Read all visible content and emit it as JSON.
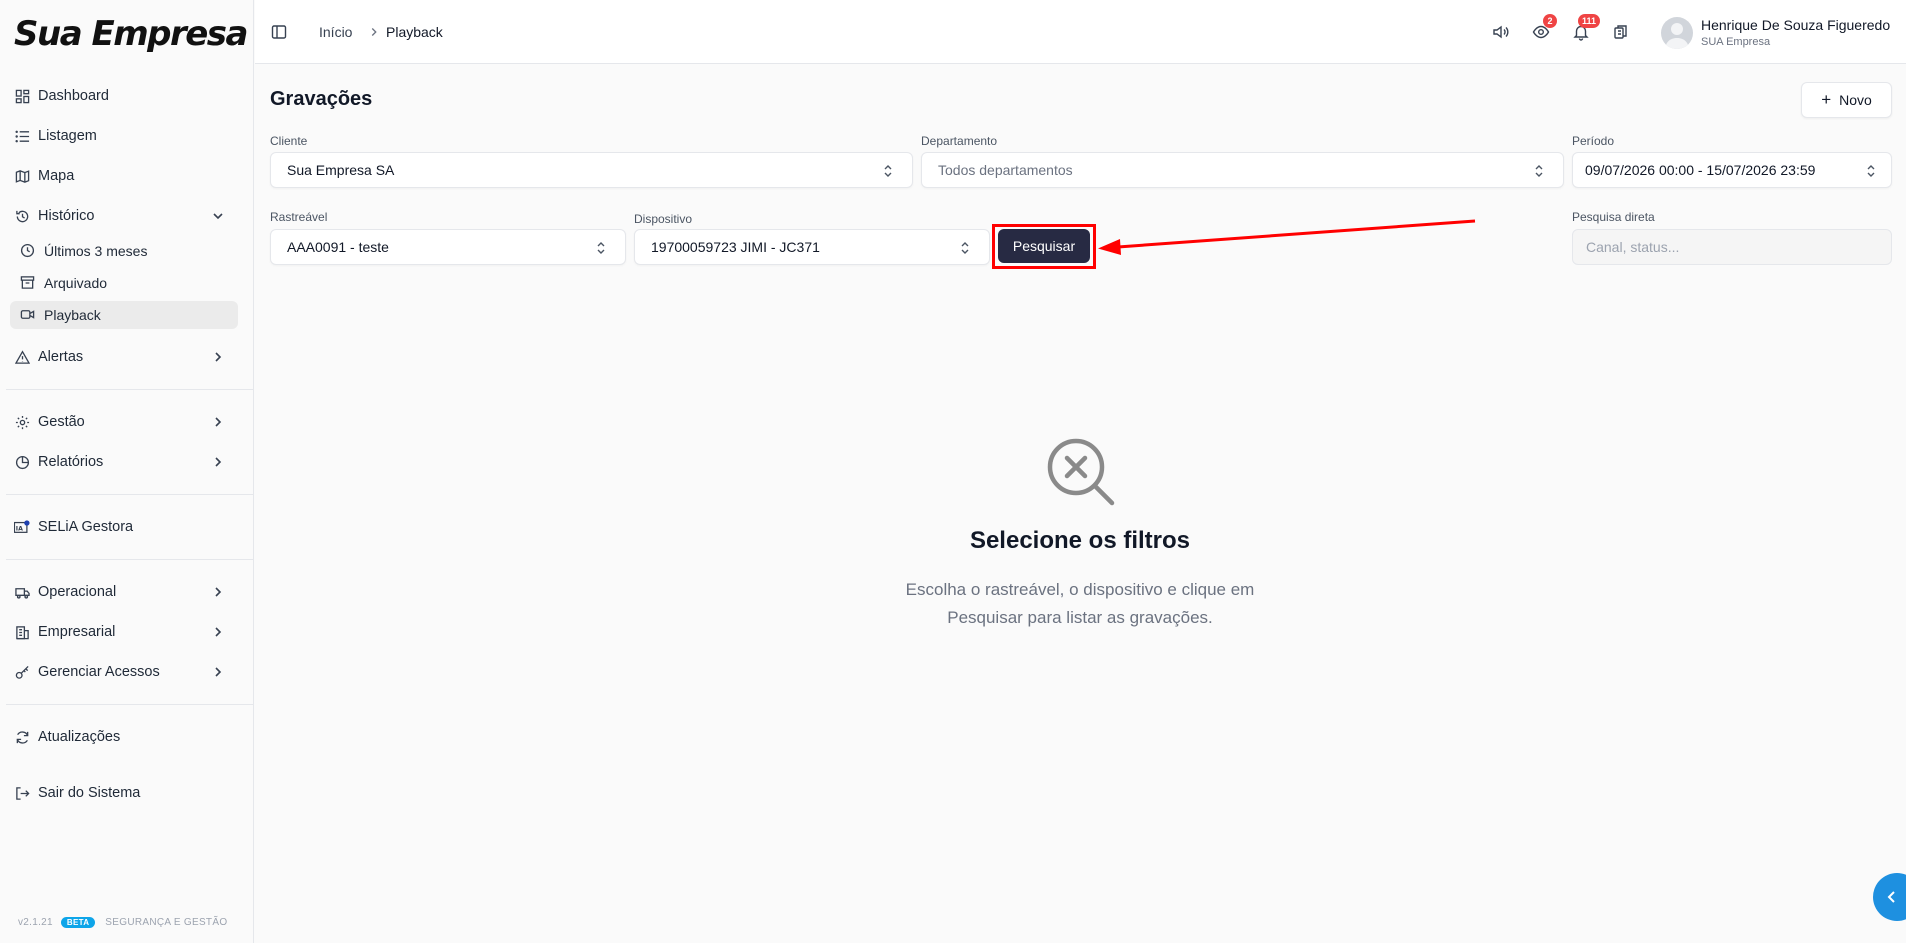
{
  "brand": {
    "logo_text": "Sua Empresa"
  },
  "sidebar": {
    "items": [
      {
        "label": "Dashboard",
        "icon": "dashboard-icon"
      },
      {
        "label": "Listagem",
        "icon": "list-icon"
      },
      {
        "label": "Mapa",
        "icon": "map-icon"
      },
      {
        "label": "Histórico",
        "icon": "history-icon",
        "expanded": true
      },
      {
        "label": "Alertas",
        "icon": "alert-icon"
      },
      {
        "label": "Gestão",
        "icon": "gear-icon"
      },
      {
        "label": "Relatórios",
        "icon": "report-icon"
      },
      {
        "label": "SELiA Gestora",
        "icon": "ai-icon"
      },
      {
        "label": "Operacional",
        "icon": "truck-icon"
      },
      {
        "label": "Empresarial",
        "icon": "building-icon"
      },
      {
        "label": "Gerenciar Acessos",
        "icon": "key-icon"
      },
      {
        "label": "Atualizações",
        "icon": "refresh-icon"
      },
      {
        "label": "Sair do Sistema",
        "icon": "logout-icon"
      }
    ],
    "historico_sub": [
      {
        "label": "Últimos 3 meses",
        "icon": "clock-icon"
      },
      {
        "label": "Arquivado",
        "icon": "archive-icon"
      },
      {
        "label": "Playback",
        "icon": "video-icon",
        "active": true
      }
    ],
    "footer": {
      "version": "v2.1.21",
      "beta": "BETA",
      "tagline": "SEGURANÇA E GESTÃO"
    }
  },
  "topbar": {
    "breadcrumb": [
      "Início",
      "Playback"
    ],
    "badges": {
      "eye": "2",
      "bell": "111"
    },
    "user": {
      "name": "Henrique De Souza Figueredo",
      "org": "SUA Empresa"
    }
  },
  "main": {
    "title": "Gravações",
    "new_button": "Novo",
    "filters": {
      "cliente": {
        "label": "Cliente",
        "value": "Sua Empresa SA"
      },
      "departamento": {
        "label": "Departamento",
        "value": "Todos departamentos"
      },
      "periodo": {
        "label": "Período",
        "value": "09/07/2026 00:00 - 15/07/2026 23:59"
      },
      "rastreavel": {
        "label": "Rastreável",
        "value": "AAA0091 - teste"
      },
      "dispositivo": {
        "label": "Dispositivo",
        "value": "19700059723 JIMI - JC371"
      },
      "pesquisa_direta": {
        "label": "Pesquisa direta",
        "placeholder": "Canal, status..."
      }
    },
    "search_button": "Pesquisar",
    "empty_state": {
      "title": "Selecione os filtros",
      "description": "Escolha o rastreável, o dispositivo e clique em Pesquisar para listar as gravações."
    }
  },
  "colors": {
    "primary_button": "#272a43",
    "annotation_red": "#ff0000",
    "badge_red": "#ef4444",
    "beta_blue": "#0ea5e9",
    "fab_blue": "#1e90e0"
  }
}
